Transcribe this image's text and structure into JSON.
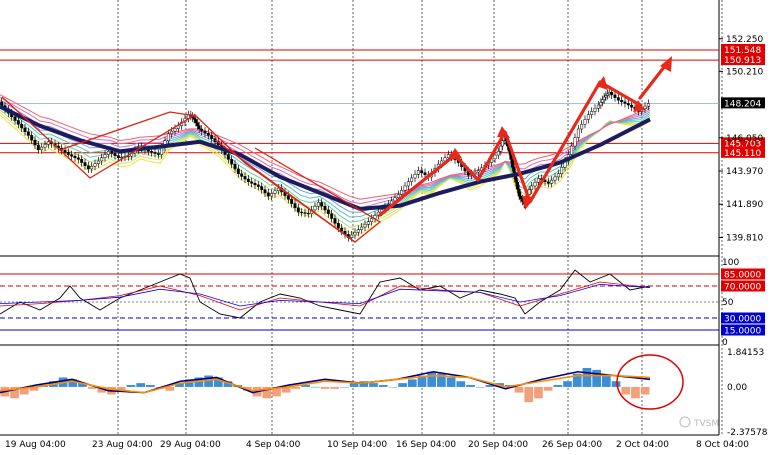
{
  "chart_data": [
    {
      "type": "line",
      "panel": "price",
      "title": "",
      "ylim": [
        138.9,
        153.8
      ],
      "price_ticks": [
        "152.250",
        "150.210",
        "148.204",
        "146.050",
        "143.970",
        "141.890",
        "139.810"
      ],
      "price_tick_values": [
        152.25,
        150.21,
        148.204,
        146.05,
        143.97,
        141.89,
        139.81
      ],
      "horizontal_levels": [
        {
          "value": 151.548,
          "label": "151.548",
          "color": "#e00000"
        },
        {
          "value": 150.913,
          "label": "150.913",
          "color": "#e00000"
        },
        {
          "value": 145.703,
          "label": "145.703",
          "color": "#e00000"
        },
        {
          "value": 145.11,
          "label": "145.110",
          "color": "#e00000"
        }
      ],
      "current_price": {
        "value": 148.204,
        "label": "148.204"
      },
      "x_labels": [
        "19 Aug 04:00",
        "23 Aug 04:00",
        "29 Aug 04:00",
        "4 Sep 04:00",
        "10 Sep 04:00",
        "16 Sep 04:00",
        "20 Sep 04:00",
        "26 Sep 04:00",
        "2 Oct 04:00",
        "8 Oct 04:00"
      ],
      "price_path": [
        [
          0,
          148.3
        ],
        [
          10,
          147.6
        ],
        [
          20,
          146.9
        ],
        [
          30,
          146.2
        ],
        [
          40,
          145.3
        ],
        [
          50,
          145.8
        ],
        [
          60,
          145.4
        ],
        [
          70,
          145.0
        ],
        [
          80,
          144.7
        ],
        [
          90,
          144.1
        ],
        [
          100,
          144.6
        ],
        [
          110,
          145.2
        ],
        [
          120,
          144.8
        ],
        [
          130,
          144.9
        ],
        [
          140,
          145.5
        ],
        [
          150,
          145.2
        ],
        [
          160,
          145.0
        ],
        [
          170,
          146.3
        ],
        [
          180,
          146.8
        ],
        [
          190,
          147.5
        ],
        [
          195,
          147.2
        ],
        [
          200,
          146.6
        ],
        [
          210,
          146.2
        ],
        [
          220,
          145.6
        ],
        [
          230,
          144.7
        ],
        [
          240,
          143.8
        ],
        [
          250,
          143.3
        ],
        [
          260,
          143.0
        ],
        [
          270,
          142.4
        ],
        [
          280,
          142.9
        ],
        [
          290,
          142.2
        ],
        [
          300,
          141.4
        ],
        [
          310,
          141.3
        ],
        [
          320,
          142.0
        ],
        [
          330,
          141.3
        ],
        [
          340,
          140.4
        ],
        [
          350,
          139.8
        ],
        [
          360,
          140.3
        ],
        [
          370,
          140.8
        ],
        [
          380,
          141.4
        ],
        [
          390,
          141.9
        ],
        [
          400,
          142.5
        ],
        [
          410,
          143.3
        ],
        [
          420,
          144.0
        ],
        [
          430,
          143.6
        ],
        [
          440,
          144.4
        ],
        [
          450,
          145.0
        ],
        [
          460,
          144.5
        ],
        [
          470,
          143.7
        ],
        [
          480,
          144.0
        ],
        [
          490,
          144.5
        ],
        [
          500,
          145.2
        ],
        [
          505,
          146.2
        ],
        [
          510,
          145.2
        ],
        [
          515,
          143.7
        ],
        [
          520,
          142.4
        ],
        [
          525,
          141.9
        ],
        [
          530,
          142.8
        ],
        [
          540,
          143.5
        ],
        [
          550,
          143.2
        ],
        [
          560,
          143.8
        ],
        [
          570,
          145.0
        ],
        [
          580,
          146.6
        ],
        [
          590,
          147.5
        ],
        [
          600,
          148.1
        ],
        [
          605,
          148.6
        ],
        [
          610,
          148.9
        ],
        [
          620,
          148.4
        ],
        [
          630,
          148.1
        ],
        [
          640,
          147.7
        ],
        [
          650,
          148.2
        ]
      ],
      "ma_path": [
        [
          0,
          148.0
        ],
        [
          40,
          146.8
        ],
        [
          80,
          145.9
        ],
        [
          120,
          145.2
        ],
        [
          160,
          145.5
        ],
        [
          200,
          145.8
        ],
        [
          240,
          145.0
        ],
        [
          280,
          143.6
        ],
        [
          320,
          142.6
        ],
        [
          360,
          141.6
        ],
        [
          400,
          141.8
        ],
        [
          440,
          142.6
        ],
        [
          480,
          143.3
        ],
        [
          520,
          143.8
        ],
        [
          560,
          144.5
        ],
        [
          600,
          145.6
        ],
        [
          650,
          147.2
        ]
      ],
      "annotations": [
        "zigzag-lines",
        "up-arrows"
      ]
    },
    {
      "type": "line",
      "panel": "oscillator",
      "ylim": [
        0,
        100
      ],
      "scale_labels": [
        "100",
        "50",
        "0"
      ],
      "levels": [
        {
          "value": 85,
          "label": "85.0000",
          "color": "#e00000",
          "style": "solid"
        },
        {
          "value": 70,
          "label": "70.0000",
          "color": "#e00000",
          "style": "dashed"
        },
        {
          "value": 30,
          "label": "30.0000",
          "color": "#0000cc",
          "style": "dashed"
        },
        {
          "value": 15,
          "label": "15.0000",
          "color": "#0000cc",
          "style": "solid"
        }
      ],
      "series": [
        {
          "color": "#000000",
          "values": [
            [
              0,
              35
            ],
            [
              20,
              50
            ],
            [
              40,
              40
            ],
            [
              60,
              55
            ],
            [
              70,
              70
            ],
            [
              80,
              55
            ],
            [
              100,
              40
            ],
            [
              120,
              55
            ],
            [
              140,
              65
            ],
            [
              160,
              75
            ],
            [
              180,
              85
            ],
            [
              190,
              80
            ],
            [
              200,
              50
            ],
            [
              220,
              35
            ],
            [
              240,
              30
            ],
            [
              260,
              50
            ],
            [
              280,
              60
            ],
            [
              300,
              55
            ],
            [
              320,
              45
            ],
            [
              340,
              40
            ],
            [
              360,
              35
            ],
            [
              380,
              75
            ],
            [
              400,
              80
            ],
            [
              420,
              65
            ],
            [
              440,
              70
            ],
            [
              460,
              55
            ],
            [
              480,
              65
            ],
            [
              500,
              60
            ],
            [
              515,
              55
            ],
            [
              525,
              35
            ],
            [
              540,
              50
            ],
            [
              560,
              65
            ],
            [
              575,
              90
            ],
            [
              590,
              75
            ],
            [
              610,
              85
            ],
            [
              630,
              65
            ],
            [
              650,
              70
            ]
          ]
        },
        {
          "color": "#e00000",
          "values": [
            [
              0,
              45
            ],
            [
              40,
              48
            ],
            [
              80,
              52
            ],
            [
              120,
              58
            ],
            [
              160,
              70
            ],
            [
              200,
              58
            ],
            [
              240,
              40
            ],
            [
              280,
              55
            ],
            [
              320,
              50
            ],
            [
              360,
              45
            ],
            [
              400,
              70
            ],
            [
              440,
              65
            ],
            [
              480,
              62
            ],
            [
              520,
              45
            ],
            [
              560,
              60
            ],
            [
              600,
              75
            ],
            [
              650,
              68
            ]
          ]
        },
        {
          "color": "#0000ff",
          "values": [
            [
              0,
              48
            ],
            [
              40,
              50
            ],
            [
              80,
              52
            ],
            [
              120,
              56
            ],
            [
              160,
              66
            ],
            [
              200,
              60
            ],
            [
              240,
              45
            ],
            [
              280,
              52
            ],
            [
              320,
              50
            ],
            [
              360,
              48
            ],
            [
              400,
              66
            ],
            [
              440,
              64
            ],
            [
              480,
              62
            ],
            [
              520,
              50
            ],
            [
              560,
              58
            ],
            [
              600,
              72
            ],
            [
              650,
              68
            ]
          ]
        }
      ]
    },
    {
      "type": "bar",
      "panel": "histogram",
      "ylim": [
        -2.37578,
        1.84153
      ],
      "scale_labels": [
        "1.84153",
        "0.00",
        "-2.37578"
      ],
      "values": [
        -0.5,
        -0.6,
        -0.4,
        -0.2,
        0.1,
        0.3,
        0.5,
        0.4,
        0.2,
        -0.1,
        -0.3,
        -0.4,
        -0.2,
        0.1,
        0.2,
        0.1,
        -0.1,
        -0.2,
        0.2,
        0.4,
        0.5,
        0.6,
        0.5,
        0.3,
        0.1,
        -0.2,
        -0.5,
        -0.6,
        -0.5,
        -0.3,
        -0.1,
        0.1,
        0.0,
        -0.1,
        -0.1,
        0.0,
        0.2,
        0.3,
        0.2,
        0.1,
        0.0,
        0.2,
        0.4,
        0.6,
        0.8,
        0.7,
        0.5,
        0.3,
        0.1,
        0.0,
        0.1,
        0.2,
        0.1,
        -0.3,
        -0.8,
        -0.6,
        -0.2,
        0.1,
        0.3,
        0.7,
        1.0,
        0.9,
        0.6,
        0.3,
        -0.4,
        -0.6,
        -0.4
      ],
      "bar_colors": {
        "positive": "#3a8fd8",
        "negative": "#f2a07b"
      },
      "signal_lines": [
        {
          "color": "#000080",
          "values": [
            -0.3,
            0.1,
            0.4,
            -0.2,
            -0.3,
            0.3,
            0.5,
            -0.3,
            0.1,
            0.4,
            0.2,
            0.4,
            0.8,
            0.5,
            -0.1,
            0.4,
            0.8,
            0.6,
            0.4
          ]
        },
        {
          "color": "#ff8c00",
          "values": [
            -0.2,
            0.0,
            0.3,
            -0.1,
            -0.3,
            0.2,
            0.4,
            -0.2,
            0.0,
            0.3,
            0.2,
            0.4,
            0.6,
            0.5,
            0.0,
            0.3,
            0.6,
            0.6,
            0.5
          ]
        }
      ]
    }
  ],
  "watermark": "TVSM"
}
